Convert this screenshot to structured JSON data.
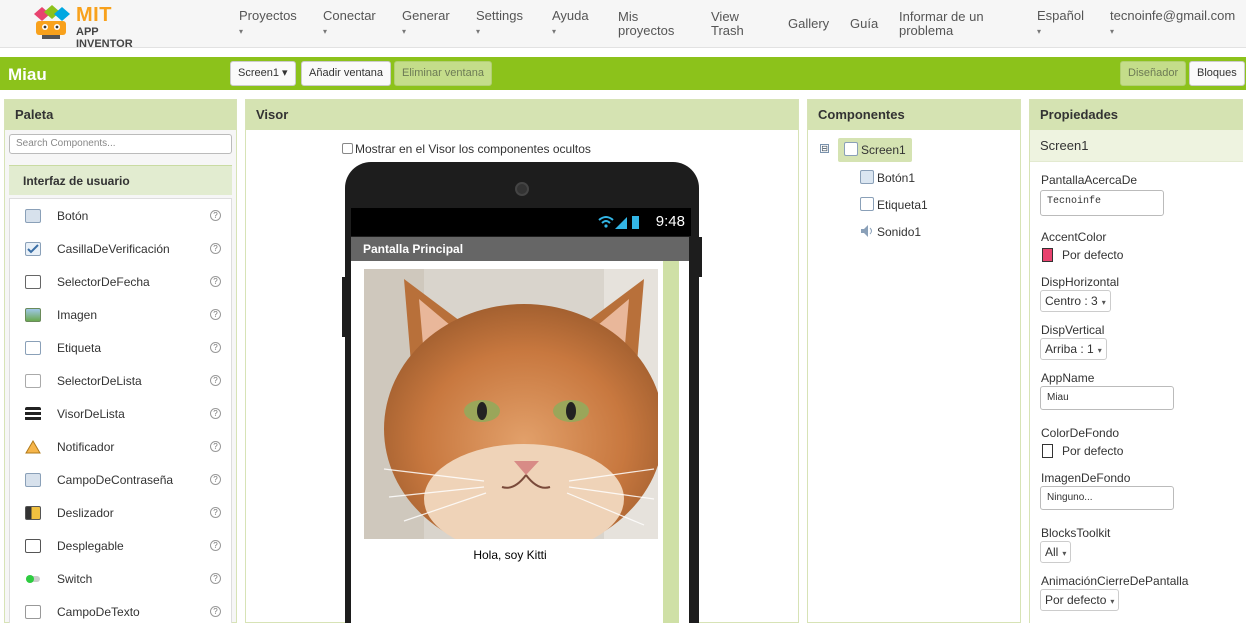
{
  "nav": {
    "logo_mit": "MIT",
    "logo_sub": "APP INVENTOR",
    "items": [
      {
        "label": "Proyectos",
        "caret": "▾"
      },
      {
        "label": "Conectar",
        "caret": "▾"
      },
      {
        "label": "Generar",
        "caret": "▾"
      },
      {
        "label": "Settings",
        "caret": "▾"
      },
      {
        "label": "Ayuda",
        "caret": "▾"
      }
    ],
    "links": {
      "mis_proyectos_1": "Mis",
      "mis_proyectos_2": "proyectos",
      "view_trash_1": "View",
      "view_trash_2": "Trash",
      "gallery": "Gallery",
      "guia": "Guía",
      "informar_1": "Informar de un",
      "informar_2": "problema"
    },
    "language": {
      "label": "Español",
      "caret": "▾"
    },
    "account": {
      "label": "tecnoinfe@gmail.com",
      "caret": "▾"
    }
  },
  "toolbar": {
    "project_name": "Miau",
    "screen_select": "Screen1 ▾",
    "add_screen": "Añadir ventana",
    "remove_screen": "Eliminar ventana",
    "designer": "Diseñador",
    "blocks": "Bloques"
  },
  "palette": {
    "title": "Paleta",
    "search_placeholder": "Search Components...",
    "section": "Interfaz de usuario",
    "help_glyph": "?",
    "items": [
      {
        "label": "Botón",
        "icon": "button-icon"
      },
      {
        "label": "CasillaDeVerificación",
        "icon": "checkbox-icon"
      },
      {
        "label": "SelectorDeFecha",
        "icon": "datepicker-icon"
      },
      {
        "label": "Imagen",
        "icon": "image-icon"
      },
      {
        "label": "Etiqueta",
        "icon": "label-icon"
      },
      {
        "label": "SelectorDeLista",
        "icon": "listpicker-icon"
      },
      {
        "label": "VisorDeLista",
        "icon": "listview-icon"
      },
      {
        "label": "Notificador",
        "icon": "notifier-icon"
      },
      {
        "label": "CampoDeContraseña",
        "icon": "password-icon"
      },
      {
        "label": "Deslizador",
        "icon": "slider-icon"
      },
      {
        "label": "Desplegable",
        "icon": "spinner-icon"
      },
      {
        "label": "Switch",
        "icon": "switch-icon"
      },
      {
        "label": "CampoDeTexto",
        "icon": "textbox-icon"
      }
    ]
  },
  "viewer": {
    "title": "Visor",
    "show_hidden": "Mostrar en el Visor los componentes ocultos",
    "status_time": "9:48",
    "screen_title": "Pantalla Principal",
    "label_text": "Hola, soy Kitti"
  },
  "components": {
    "title": "Componentes",
    "toggle": "⊟",
    "tree": [
      {
        "label": "Screen1",
        "icon": "screen-icon"
      },
      {
        "label": "Botón1",
        "icon": "button-icon"
      },
      {
        "label": "Etiqueta1",
        "icon": "label-icon"
      },
      {
        "label": "Sonido1",
        "icon": "sound-icon"
      }
    ]
  },
  "properties": {
    "title": "Propiedades",
    "component": "Screen1",
    "about_label": "PantallaAcercaDe",
    "about_value": "Tecnoinfe",
    "accent_label": "AccentColor",
    "accent_value": "Por defecto",
    "accent_color": "#e8436f",
    "halign_label": "DispHorizontal",
    "halign_value": "Centro : 3",
    "valign_label": "DispVertical",
    "valign_value": "Arriba : 1",
    "appname_label": "AppName",
    "appname_value": "Miau",
    "bg_label": "ColorDeFondo",
    "bg_value": "Por defecto",
    "bg_color": "#ffffff",
    "bgimg_label": "ImagenDeFondo",
    "bgimg_value": "Ninguno...",
    "toolkit_label": "BlocksToolkit",
    "toolkit_value": "All",
    "anim_label": "AnimaciónCierreDePantalla",
    "anim_value": "Por defecto",
    "dropdown_glyph": "▾"
  },
  "colors": {
    "brand_green": "#8cc21b",
    "panel_head": "#d5e3b2",
    "logo_orange": "#f8a11c"
  }
}
